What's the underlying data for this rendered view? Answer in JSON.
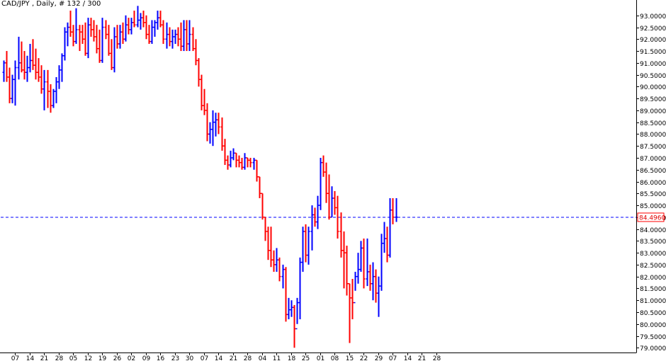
{
  "header": {
    "title": "CAD/JPY , Daily, # 132 / 300"
  },
  "colors": {
    "background": "#ffffff",
    "up_bar": "#0000ff",
    "down_bar": "#ff0000",
    "current_price_line": "#0000ff",
    "price_tag_border": "#ff0000",
    "price_tag_text": "#e00000",
    "axis": "#000000"
  },
  "chart_data": {
    "type": "ohlc",
    "title": "CAD/JPY , Daily, # 132 / 300",
    "xlabel": "",
    "ylabel": "",
    "ylim": [
      78.8,
      93.35
    ],
    "yticks": [
      79.0,
      79.5,
      80.0,
      80.5,
      81.0,
      81.5,
      82.0,
      82.5,
      83.0,
      83.5,
      84.0,
      84.5,
      85.0,
      85.5,
      86.0,
      86.5,
      87.0,
      87.5,
      88.0,
      88.5,
      89.0,
      89.5,
      90.0,
      90.5,
      91.0,
      91.5,
      92.0,
      92.5,
      93.0
    ],
    "ytick_labels": [
      "79.0000",
      "79.5000",
      "80.0000",
      "80.5000",
      "81.0000",
      "81.5000",
      "82.0000",
      "82.5000",
      "83.0000",
      "83.5000",
      "84.0000",
      "84.5000",
      "85.0000",
      "85.5000",
      "86.0000",
      "86.5000",
      "87.0000",
      "87.5000",
      "88.0000",
      "88.5000",
      "89.0000",
      "89.5000",
      "90.0000",
      "90.5000",
      "91.0000",
      "91.5000",
      "92.0000",
      "92.5000",
      "93.0000"
    ],
    "xtick_labels": [
      "07",
      "14",
      "21",
      "28",
      "05",
      "12",
      "19",
      "26",
      "02",
      "09",
      "16",
      "23",
      "30",
      "07",
      "14",
      "21",
      "28",
      "04",
      "11",
      "18",
      "25",
      "01",
      "08",
      "15",
      "22",
      "29",
      "07",
      "14",
      "21",
      "28"
    ],
    "xtick_bar_index": [
      4,
      9,
      14,
      19,
      24,
      29,
      34,
      39,
      44,
      49,
      54,
      59,
      64,
      69,
      74,
      79,
      84,
      89,
      94,
      99,
      104,
      109,
      114,
      119,
      124,
      129,
      134,
      139,
      144,
      149
    ],
    "current_price": 84.496,
    "current_price_label": "84.4960",
    "grid": false,
    "bars": [
      {
        "o": 90.6,
        "h": 91.1,
        "l": 90.2,
        "c": 91.0
      },
      {
        "o": 91.0,
        "h": 91.5,
        "l": 90.2,
        "c": 90.4
      },
      {
        "o": 90.4,
        "h": 90.8,
        "l": 89.3,
        "c": 89.5
      },
      {
        "o": 89.5,
        "h": 90.5,
        "l": 89.3,
        "c": 90.3
      },
      {
        "o": 90.3,
        "h": 91.1,
        "l": 89.2,
        "c": 90.8
      },
      {
        "o": 90.8,
        "h": 92.1,
        "l": 90.3,
        "c": 91.0
      },
      {
        "o": 91.0,
        "h": 91.9,
        "l": 90.6,
        "c": 90.7
      },
      {
        "o": 90.7,
        "h": 91.5,
        "l": 90.3,
        "c": 90.6
      },
      {
        "o": 90.6,
        "h": 91.3,
        "l": 90.2,
        "c": 90.8
      },
      {
        "o": 90.8,
        "h": 91.8,
        "l": 90.6,
        "c": 91.1
      },
      {
        "o": 91.1,
        "h": 92.0,
        "l": 90.7,
        "c": 90.9
      },
      {
        "o": 90.9,
        "h": 91.6,
        "l": 90.3,
        "c": 90.6
      },
      {
        "o": 90.6,
        "h": 91.2,
        "l": 90.2,
        "c": 90.4
      },
      {
        "o": 90.4,
        "h": 90.9,
        "l": 89.7,
        "c": 89.9
      },
      {
        "o": 89.9,
        "h": 90.7,
        "l": 89.0,
        "c": 90.2
      },
      {
        "o": 90.2,
        "h": 90.7,
        "l": 89.1,
        "c": 89.8
      },
      {
        "o": 89.8,
        "h": 90.1,
        "l": 88.9,
        "c": 89.2
      },
      {
        "o": 89.2,
        "h": 89.9,
        "l": 89.1,
        "c": 89.8
      },
      {
        "o": 89.8,
        "h": 90.4,
        "l": 89.3,
        "c": 90.2
      },
      {
        "o": 90.2,
        "h": 90.9,
        "l": 89.9,
        "c": 90.7
      },
      {
        "o": 90.7,
        "h": 91.4,
        "l": 90.2,
        "c": 91.3
      },
      {
        "o": 91.3,
        "h": 92.5,
        "l": 91.1,
        "c": 92.3
      },
      {
        "o": 92.3,
        "h": 92.7,
        "l": 91.7,
        "c": 92.5
      },
      {
        "o": 92.5,
        "h": 93.2,
        "l": 92.1,
        "c": 92.3
      },
      {
        "o": 92.3,
        "h": 92.6,
        "l": 91.7,
        "c": 91.9
      },
      {
        "o": 91.9,
        "h": 93.3,
        "l": 91.8,
        "c": 92.4
      },
      {
        "o": 92.4,
        "h": 92.6,
        "l": 91.5,
        "c": 92.3
      },
      {
        "o": 92.3,
        "h": 92.6,
        "l": 91.8,
        "c": 92.0
      },
      {
        "o": 92.0,
        "h": 92.7,
        "l": 91.3,
        "c": 91.4
      },
      {
        "o": 91.4,
        "h": 92.9,
        "l": 91.2,
        "c": 92.6
      },
      {
        "o": 92.6,
        "h": 92.9,
        "l": 92.1,
        "c": 92.4
      },
      {
        "o": 92.4,
        "h": 92.8,
        "l": 91.9,
        "c": 92.1
      },
      {
        "o": 92.1,
        "h": 92.6,
        "l": 91.4,
        "c": 91.6
      },
      {
        "o": 91.6,
        "h": 92.4,
        "l": 91.0,
        "c": 91.1
      },
      {
        "o": 91.1,
        "h": 92.9,
        "l": 91.0,
        "c": 92.5
      },
      {
        "o": 92.5,
        "h": 92.8,
        "l": 92.0,
        "c": 92.2
      },
      {
        "o": 92.2,
        "h": 92.6,
        "l": 91.3,
        "c": 91.4
      },
      {
        "o": 91.4,
        "h": 92.0,
        "l": 90.7,
        "c": 90.8
      },
      {
        "o": 90.8,
        "h": 92.5,
        "l": 90.6,
        "c": 92.1
      },
      {
        "o": 92.1,
        "h": 92.6,
        "l": 91.6,
        "c": 91.8
      },
      {
        "o": 91.8,
        "h": 92.6,
        "l": 91.6,
        "c": 92.3
      },
      {
        "o": 92.3,
        "h": 92.7,
        "l": 91.8,
        "c": 92.0
      },
      {
        "o": 92.0,
        "h": 93.0,
        "l": 91.9,
        "c": 92.6
      },
      {
        "o": 92.6,
        "h": 92.9,
        "l": 92.2,
        "c": 92.4
      },
      {
        "o": 92.4,
        "h": 92.9,
        "l": 92.2,
        "c": 92.7
      },
      {
        "o": 92.7,
        "h": 93.2,
        "l": 92.5,
        "c": 92.6
      },
      {
        "o": 92.6,
        "h": 93.4,
        "l": 92.5,
        "c": 92.8
      },
      {
        "o": 92.8,
        "h": 93.1,
        "l": 92.4,
        "c": 92.9
      },
      {
        "o": 92.9,
        "h": 93.2,
        "l": 92.5,
        "c": 92.7
      },
      {
        "o": 92.7,
        "h": 93.0,
        "l": 92.0,
        "c": 92.2
      },
      {
        "o": 92.2,
        "h": 92.6,
        "l": 91.8,
        "c": 91.9
      },
      {
        "o": 91.9,
        "h": 92.8,
        "l": 91.8,
        "c": 92.5
      },
      {
        "o": 92.5,
        "h": 92.8,
        "l": 92.1,
        "c": 92.7
      },
      {
        "o": 92.7,
        "h": 93.2,
        "l": 92.4,
        "c": 92.9
      },
      {
        "o": 92.9,
        "h": 93.2,
        "l": 92.5,
        "c": 92.6
      },
      {
        "o": 92.6,
        "h": 92.8,
        "l": 91.8,
        "c": 92.0
      },
      {
        "o": 92.0,
        "h": 92.7,
        "l": 91.6,
        "c": 92.2
      },
      {
        "o": 92.2,
        "h": 92.5,
        "l": 91.7,
        "c": 91.9
      },
      {
        "o": 91.9,
        "h": 92.4,
        "l": 91.6,
        "c": 92.1
      },
      {
        "o": 92.1,
        "h": 92.4,
        "l": 91.8,
        "c": 92.2
      },
      {
        "o": 92.2,
        "h": 92.5,
        "l": 91.7,
        "c": 92.0
      },
      {
        "o": 92.0,
        "h": 92.7,
        "l": 91.5,
        "c": 91.7
      },
      {
        "o": 91.7,
        "h": 92.8,
        "l": 91.5,
        "c": 92.4
      },
      {
        "o": 92.4,
        "h": 92.8,
        "l": 91.5,
        "c": 91.8
      },
      {
        "o": 91.8,
        "h": 92.8,
        "l": 91.5,
        "c": 92.2
      },
      {
        "o": 92.2,
        "h": 92.5,
        "l": 91.5,
        "c": 91.6
      },
      {
        "o": 91.6,
        "h": 92.0,
        "l": 90.9,
        "c": 91.1
      },
      {
        "o": 91.1,
        "h": 91.2,
        "l": 90.0,
        "c": 90.3
      },
      {
        "o": 90.3,
        "h": 90.5,
        "l": 89.0,
        "c": 89.2
      },
      {
        "o": 89.2,
        "h": 89.9,
        "l": 88.8,
        "c": 89.0
      },
      {
        "o": 89.0,
        "h": 89.3,
        "l": 87.7,
        "c": 88.0
      },
      {
        "o": 88.0,
        "h": 88.5,
        "l": 87.6,
        "c": 88.2
      },
      {
        "o": 88.2,
        "h": 89.0,
        "l": 87.5,
        "c": 88.5
      },
      {
        "o": 88.5,
        "h": 88.9,
        "l": 87.9,
        "c": 88.6
      },
      {
        "o": 88.6,
        "h": 88.9,
        "l": 88.0,
        "c": 88.3
      },
      {
        "o": 88.3,
        "h": 88.7,
        "l": 87.3,
        "c": 87.5
      },
      {
        "o": 87.5,
        "h": 87.8,
        "l": 86.7,
        "c": 86.9
      },
      {
        "o": 86.9,
        "h": 87.1,
        "l": 86.5,
        "c": 86.7
      },
      {
        "o": 86.7,
        "h": 87.3,
        "l": 86.6,
        "c": 87.0
      },
      {
        "o": 87.0,
        "h": 87.4,
        "l": 86.9,
        "c": 87.2
      },
      {
        "o": 87.2,
        "h": 87.2,
        "l": 86.6,
        "c": 86.9
      },
      {
        "o": 86.9,
        "h": 87.1,
        "l": 86.6,
        "c": 86.8
      },
      {
        "o": 86.8,
        "h": 87.0,
        "l": 86.5,
        "c": 86.6
      },
      {
        "o": 86.6,
        "h": 87.2,
        "l": 86.5,
        "c": 87.0
      },
      {
        "o": 87.0,
        "h": 87.0,
        "l": 86.6,
        "c": 86.9
      },
      {
        "o": 86.9,
        "h": 87.0,
        "l": 86.6,
        "c": 86.8
      },
      {
        "o": 86.8,
        "h": 87.0,
        "l": 86.5,
        "c": 86.9
      },
      {
        "o": 86.9,
        "h": 86.9,
        "l": 86.0,
        "c": 86.2
      },
      {
        "o": 86.2,
        "h": 86.2,
        "l": 85.3,
        "c": 85.5
      },
      {
        "o": 85.5,
        "h": 85.5,
        "l": 84.4,
        "c": 84.5
      },
      {
        "o": 84.5,
        "h": 84.5,
        "l": 83.5,
        "c": 83.9
      },
      {
        "o": 83.9,
        "h": 84.1,
        "l": 82.7,
        "c": 83.1
      },
      {
        "o": 83.1,
        "h": 84.1,
        "l": 82.4,
        "c": 82.7
      },
      {
        "o": 82.7,
        "h": 83.1,
        "l": 82.2,
        "c": 82.5
      },
      {
        "o": 82.5,
        "h": 83.2,
        "l": 82.2,
        "c": 82.7
      },
      {
        "o": 82.7,
        "h": 82.8,
        "l": 81.8,
        "c": 82.0
      },
      {
        "o": 82.0,
        "h": 82.5,
        "l": 81.5,
        "c": 82.3
      },
      {
        "o": 82.3,
        "h": 82.4,
        "l": 80.1,
        "c": 80.4
      },
      {
        "o": 80.4,
        "h": 81.1,
        "l": 80.2,
        "c": 80.6
      },
      {
        "o": 80.6,
        "h": 81.0,
        "l": 80.3,
        "c": 80.7
      },
      {
        "o": 80.7,
        "h": 80.8,
        "l": 79.0,
        "c": 79.8
      },
      {
        "o": 79.8,
        "h": 81.1,
        "l": 80.0,
        "c": 80.9
      },
      {
        "o": 80.9,
        "h": 82.8,
        "l": 80.2,
        "c": 82.6
      },
      {
        "o": 82.6,
        "h": 84.1,
        "l": 82.2,
        "c": 83.9
      },
      {
        "o": 83.9,
        "h": 84.2,
        "l": 82.6,
        "c": 82.9
      },
      {
        "o": 82.9,
        "h": 84.1,
        "l": 82.5,
        "c": 83.9
      },
      {
        "o": 83.9,
        "h": 85.0,
        "l": 83.1,
        "c": 84.6
      },
      {
        "o": 84.6,
        "h": 84.9,
        "l": 84.1,
        "c": 84.3
      },
      {
        "o": 84.3,
        "h": 85.4,
        "l": 84.0,
        "c": 85.0
      },
      {
        "o": 85.0,
        "h": 87.0,
        "l": 84.8,
        "c": 86.8
      },
      {
        "o": 86.8,
        "h": 87.1,
        "l": 86.2,
        "c": 86.4
      },
      {
        "o": 86.4,
        "h": 86.8,
        "l": 85.1,
        "c": 85.5
      },
      {
        "o": 85.5,
        "h": 86.3,
        "l": 84.4,
        "c": 84.5
      },
      {
        "o": 84.5,
        "h": 85.8,
        "l": 84.5,
        "c": 85.3
      },
      {
        "o": 85.3,
        "h": 85.6,
        "l": 84.6,
        "c": 84.9
      },
      {
        "o": 84.9,
        "h": 85.4,
        "l": 83.6,
        "c": 83.9
      },
      {
        "o": 83.9,
        "h": 84.7,
        "l": 82.8,
        "c": 83.1
      },
      {
        "o": 83.1,
        "h": 83.9,
        "l": 81.5,
        "c": 83.0
      },
      {
        "o": 83.0,
        "h": 83.3,
        "l": 81.2,
        "c": 81.7
      },
      {
        "o": 81.7,
        "h": 81.7,
        "l": 79.2,
        "c": 81.1
      },
      {
        "o": 81.1,
        "h": 81.9,
        "l": 80.2,
        "c": 80.9
      },
      {
        "o": 80.9,
        "h": 82.2,
        "l": 81.4,
        "c": 82.0
      },
      {
        "o": 82.0,
        "h": 83.0,
        "l": 81.7,
        "c": 82.3
      },
      {
        "o": 82.3,
        "h": 83.5,
        "l": 82.2,
        "c": 83.2
      },
      {
        "o": 83.2,
        "h": 83.6,
        "l": 81.5,
        "c": 81.9
      },
      {
        "o": 81.9,
        "h": 83.6,
        "l": 81.6,
        "c": 82.2
      },
      {
        "o": 82.2,
        "h": 82.5,
        "l": 81.4,
        "c": 81.7
      },
      {
        "o": 81.7,
        "h": 82.6,
        "l": 81.0,
        "c": 82.0
      },
      {
        "o": 82.0,
        "h": 82.3,
        "l": 80.9,
        "c": 81.3
      },
      {
        "o": 81.3,
        "h": 82.0,
        "l": 80.3,
        "c": 81.6
      },
      {
        "o": 81.6,
        "h": 83.8,
        "l": 81.4,
        "c": 83.4
      },
      {
        "o": 83.4,
        "h": 84.3,
        "l": 83.0,
        "c": 83.6
      },
      {
        "o": 83.6,
        "h": 84.1,
        "l": 82.6,
        "c": 82.9
      },
      {
        "o": 82.9,
        "h": 85.3,
        "l": 82.8,
        "c": 84.8
      },
      {
        "o": 84.8,
        "h": 85.3,
        "l": 84.2,
        "c": 84.5
      },
      {
        "o": 84.5,
        "h": 85.3,
        "l": 84.3,
        "c": 84.5
      }
    ]
  }
}
